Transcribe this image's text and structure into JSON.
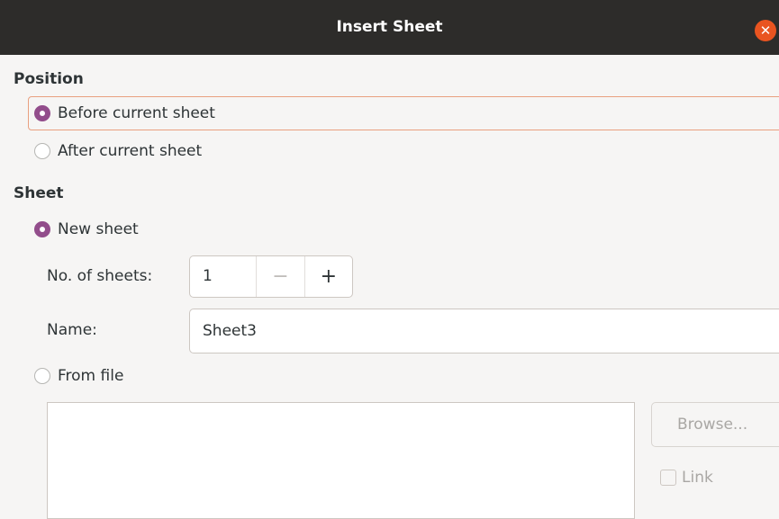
{
  "window": {
    "title": "Insert Sheet",
    "close_glyph": "✕"
  },
  "position": {
    "heading": "Position",
    "options": [
      {
        "label": "Before current sheet",
        "checked": true
      },
      {
        "label": "After current sheet",
        "checked": false
      }
    ]
  },
  "sheet": {
    "heading": "Sheet",
    "new_sheet_label": "New sheet",
    "no_of_sheets_label": "No. of sheets:",
    "no_of_sheets_value": "1",
    "minus": "−",
    "plus": "+",
    "name_label": "Name:",
    "name_value": "Sheet3",
    "from_file_label": "From file",
    "browse_label": "Browse...",
    "link_label": "Link"
  },
  "colors": {
    "accent": "#924d8b",
    "titlebar": "#2d2c2a",
    "close": "#e95420",
    "focus": "#e9a07f"
  }
}
